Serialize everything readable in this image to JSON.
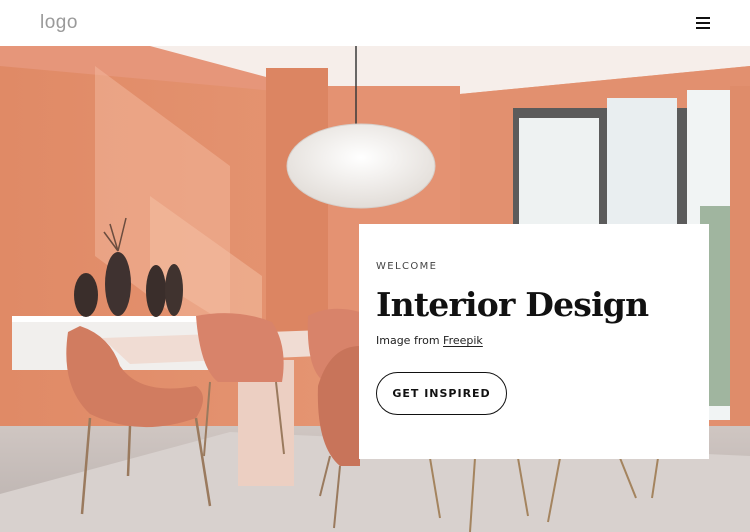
{
  "header": {
    "logo_text": "logo",
    "menu_icon": "hamburger-menu-icon"
  },
  "hero": {
    "image_subject": "dining-room-interior",
    "accent_color": "#e99a77",
    "card": {
      "eyebrow": "WELCOME",
      "title": "Interior Design",
      "credit_prefix": "Image from",
      "credit_link": "Freepik",
      "cta_label": "GET INSPIRED"
    }
  }
}
